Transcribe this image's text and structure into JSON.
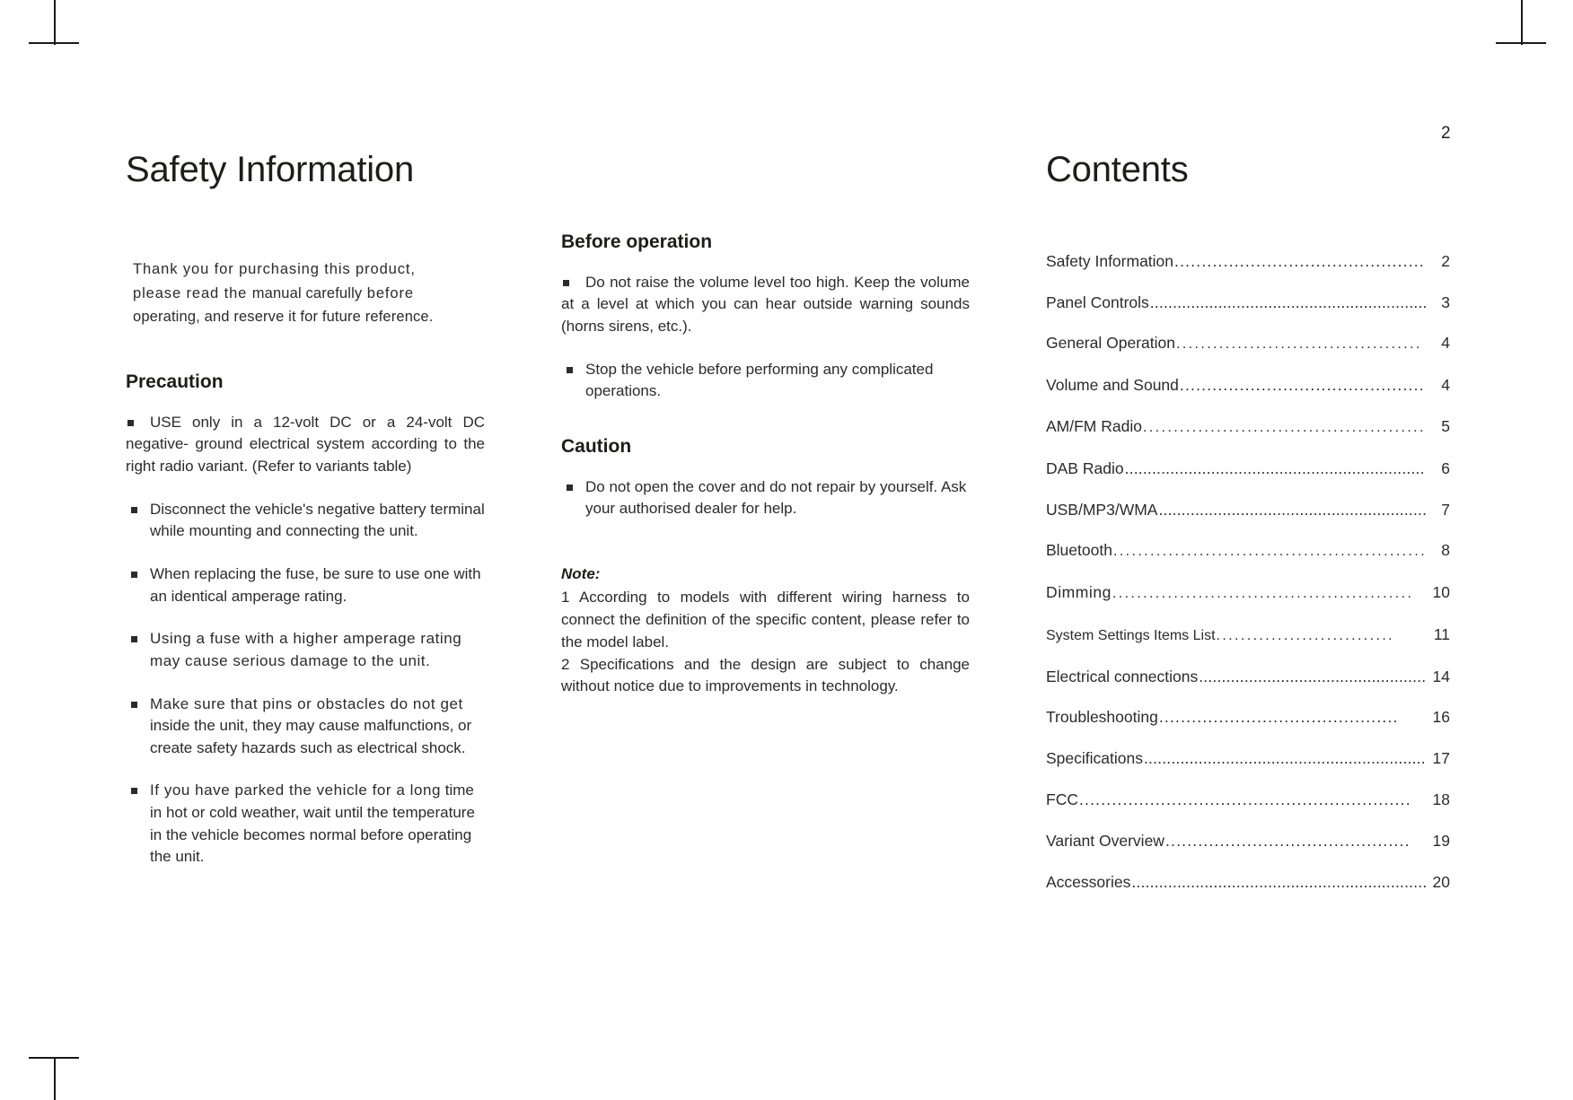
{
  "page": {
    "number": "2"
  },
  "left": {
    "title": "Safety Information",
    "intro_line1": "Thank you for purchasing this product,",
    "intro_line2_a": "please read the ",
    "intro_line2_b": "manual carefully",
    "intro_line2_c": " before",
    "intro_line3": "operating, and reserve it for future reference.",
    "precaution_heading": "Precaution",
    "precautions": [
      {
        "lead": "USE only in a 12-volt DC or a 24-volt DC",
        "rest": "negative- ground electrical system according to the  right radio variant. (Refer to variants table)"
      },
      {
        "lead": "Disconnect the vehicle's negative battery",
        "rest": "terminal while mounting and connecting the unit."
      },
      {
        "lead": "When replacing the fuse, be sure to use one",
        "rest": "with an identical amperage rating."
      },
      {
        "lead": "Using a fuse with a higher amperage rating",
        "rest": "may cause serious damage to the unit."
      },
      {
        "lead": "Make sure that pins or obstacles do not get",
        "rest": "inside the unit, they may cause malfunctions, or create safety hazards such as electrical shock."
      },
      {
        "lead": "If you have parked the vehicle for a long",
        "rest": "time in hot or cold weather, wait until the temperature in the vehicle becomes normal before operating the unit."
      }
    ]
  },
  "middle": {
    "before_operation_heading": "Before operation",
    "before_operation_items": [
      "Do not raise the volume level too high. Keep the volume at a level at which you can hear outside warning sounds  (horns sirens, etc.).",
      "Stop the vehicle before performing any complicated operations."
    ],
    "caution_heading": "Caution",
    "caution_items": [
      "Do not open the cover and do not repair by yourself.  Ask your authorised dealer for help."
    ],
    "note_title": "Note:",
    "note_items": [
      "1 According to models with different wiring harness to connect the definition of the specific content, please refer to the model label.",
      "2 Specifications and the design are subject to change without notice due to improvements in technology."
    ]
  },
  "contents": {
    "title": "Contents",
    "entries": [
      {
        "label": "Safety Information",
        "page": "2"
      },
      {
        "label": "Panel Controls",
        "page": "3"
      },
      {
        "label": "General Operation",
        "page": "4"
      },
      {
        "label": "Volume and Sound",
        "page": "4"
      },
      {
        "label": "AM/FM Radio",
        "page": "5"
      },
      {
        "label": "DAB Radio",
        "page": "6"
      },
      {
        "label": "USB/MP3/WMA",
        "page": "7"
      },
      {
        "label": "Bluetooth",
        "page": "8"
      },
      {
        "label": "Dimming",
        "page": "10"
      },
      {
        "label": "System Settings Items List",
        "page": "11"
      },
      {
        "label": "Electrical connections",
        "page": "14"
      },
      {
        "label": "Troubleshooting",
        "page": "16"
      },
      {
        "label": "Specifications",
        "page": "17"
      },
      {
        "label": "FCC",
        "page": "18"
      },
      {
        "label": "Variant Overview",
        "page": "19"
      },
      {
        "label": "Accessories",
        "page": "20"
      }
    ]
  }
}
